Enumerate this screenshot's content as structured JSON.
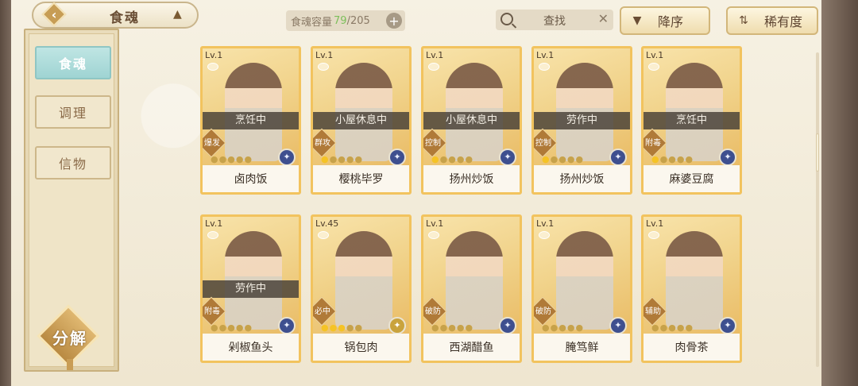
{
  "topbar": {
    "title": "食魂",
    "back_icon": "back-chevron-icon",
    "crown_icon": "crown-icon",
    "capacity_label": "食魂容量",
    "capacity_current": "79",
    "capacity_max": "/205",
    "search_placeholder": "查找",
    "sort_desc_label": "降序",
    "sort_rarity_label": "稀有度"
  },
  "sidebar": {
    "tabs": [
      {
        "label": "食魂",
        "active": true
      },
      {
        "label": "调理",
        "active": false
      },
      {
        "label": "信物",
        "active": false
      }
    ],
    "decompose_label": "分解"
  },
  "cards": [
    {
      "level": "Lv.1",
      "status": "烹饪中",
      "role": "爆发",
      "stars": 0,
      "element": "dark",
      "name": "卤肉饭"
    },
    {
      "level": "Lv.1",
      "status": "小屋休息中",
      "role": "群攻",
      "stars": 1,
      "element": "dark",
      "name": "樱桃毕罗"
    },
    {
      "level": "Lv.1",
      "status": "小屋休息中",
      "role": "控制",
      "stars": 1,
      "element": "dark",
      "name": "扬州炒饭"
    },
    {
      "level": "Lv.1",
      "status": "劳作中",
      "role": "控制",
      "stars": 1,
      "element": "dark",
      "name": "扬州炒饭"
    },
    {
      "level": "Lv.1",
      "status": "烹饪中",
      "role": "附毒",
      "stars": 1,
      "element": "dark",
      "name": "麻婆豆腐"
    },
    {
      "level": "Lv.1",
      "status": "劳作中",
      "role": "附毒",
      "stars": 0,
      "element": "dark",
      "name": "剁椒鱼头"
    },
    {
      "level": "Lv.45",
      "status": "",
      "role": "必中",
      "stars": 3,
      "element": "gold",
      "name": "锅包肉"
    },
    {
      "level": "Lv.1",
      "status": "",
      "role": "破防",
      "stars": 0,
      "element": "dark",
      "name": "西湖醋鱼"
    },
    {
      "level": "Lv.1",
      "status": "",
      "role": "破防",
      "stars": 0,
      "element": "dark",
      "name": "腌笃鲜"
    },
    {
      "level": "Lv.1",
      "status": "",
      "role": "辅助",
      "stars": 0,
      "element": "dark",
      "name": "肉骨茶"
    }
  ]
}
